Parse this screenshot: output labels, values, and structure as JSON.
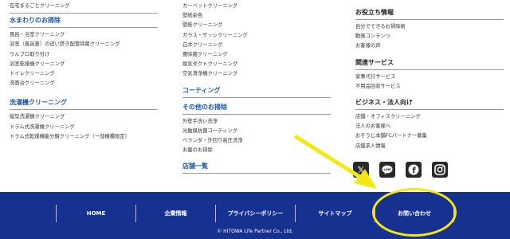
{
  "left": {
    "top_item": "在宅まるごとクリーニング",
    "sections": [
      {
        "title": "水まわりのお掃除",
        "items": [
          "風呂・浴室クリーニング",
          "浴室（風呂釜）の追い焚き配管除菌クリーニング",
          "ウルプロ取り付け",
          "浴室乾燥機クリーニング",
          "トイレクリーニング",
          "洗面台クリーニング"
        ]
      },
      {
        "title": "洗濯機クリーニング",
        "items": [
          "縦型洗濯機クリーニング",
          "ドラム式洗濯機クリーニング",
          "ドラム式乾燥機能分解クリーニング（一部機種限定）"
        ]
      }
    ]
  },
  "middle": {
    "top_items": [
      "カーペットクリーニング",
      "壁紙染色",
      "壁紙クリーニング",
      "ガラス・サッシクリーニング",
      "白木クリーニング",
      "畳除菌クリーニング",
      "換気ダクトクリーニング",
      "空気清浄機クリーニング"
    ],
    "sections": [
      {
        "title": "コーティング",
        "items": []
      },
      {
        "title": "その他のお掃除",
        "items": [
          "外壁手洗い洗浄",
          "光触媒抗菌コーティング",
          "ベランダ・外回り高圧洗浄",
          "お墓のお掃除"
        ]
      },
      {
        "title": "店舗一覧",
        "items": []
      }
    ]
  },
  "right": {
    "sections": [
      {
        "title": "お役立ち情報",
        "items": [
          "自分でできるお掃除術",
          "動画コンテンツ",
          "お客様の声"
        ]
      },
      {
        "title": "関連サービス",
        "items": [
          "家事代行サービス",
          "不用品回収サービス"
        ]
      },
      {
        "title": "ビジネス・法人向け",
        "items": [
          "店舗・オフィスクリーニング",
          "法人のお客様へ",
          "おそうじ本舗FCパートナー募集",
          "店舗求人情報"
        ]
      }
    ],
    "social": [
      {
        "icon": "x-icon",
        "glyph": "𝕏"
      },
      {
        "icon": "line-icon",
        "glyph": "LINE"
      },
      {
        "icon": "facebook-icon",
        "glyph": "f"
      },
      {
        "icon": "instagram-icon",
        "glyph": "◎"
      }
    ]
  },
  "footer": {
    "nav": [
      "HOME",
      "企業情報",
      "プライバシーポリシー",
      "サイトマップ",
      "お問い合わせ"
    ],
    "copyright": "© HITOWA Life Partner Co., Ltd."
  },
  "colors": {
    "footer_bg": "#16318f",
    "heading_blue": "#1d57ad",
    "highlight": "#f3e814"
  }
}
